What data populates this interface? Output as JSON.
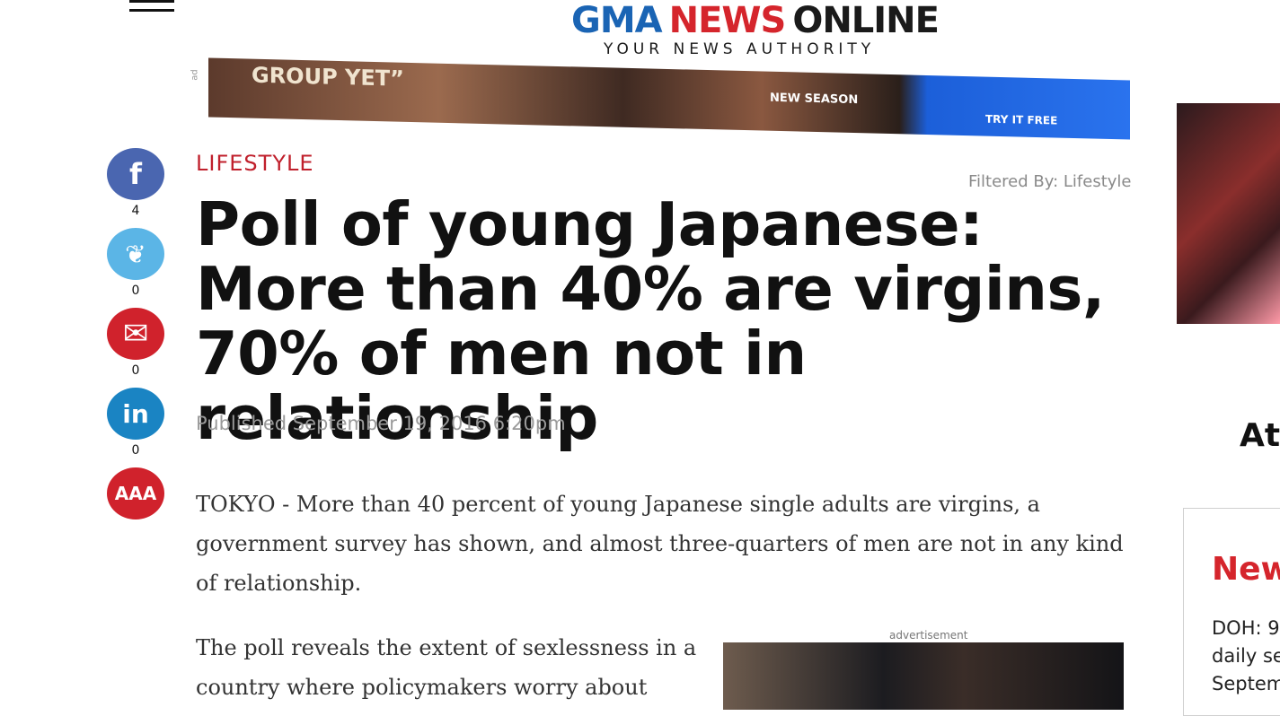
{
  "header": {
    "menu_icon": "hamburger-menu-icon",
    "logo": {
      "gma": "GMA",
      "news": "NEWS",
      "online": "ONLINE",
      "tagline": "YOUR NEWS AUTHORITY"
    }
  },
  "ad_banner": {
    "text_left": "GROUP YET”",
    "text_mid": "NEW SEASON",
    "cta": "TRY IT FREE"
  },
  "social": {
    "facebook": {
      "icon": "facebook-icon",
      "glyph": "f",
      "count": "4",
      "color": "#4a66b0"
    },
    "twitter": {
      "icon": "twitter-icon",
      "glyph": "❦",
      "count": "0",
      "color": "#5bb5e6"
    },
    "email": {
      "icon": "mail-icon",
      "glyph": "✉",
      "count": "0",
      "color": "#d0222c"
    },
    "linkedin": {
      "icon": "linkedin-icon",
      "glyph": "in",
      "count": "0",
      "color": "#1a84c3"
    },
    "font_size": {
      "icon": "font-size-icon",
      "glyph": "AAA",
      "color": "#d0222c"
    }
  },
  "article": {
    "category": "LIFESTYLE",
    "filtered_by": "Filtered By: Lifestyle",
    "headline": "Poll of young Japanese: More than 40% are virgins, 70% of men not in relationship",
    "published": "Published September 19, 2016 6:20pm",
    "paragraph1": "TOKYO - More than 40 percent of young Japanese single adults are virgins, a government survey has shown, and almost three-quarters of men are not in any kind of relationship.",
    "paragraph2": "The poll reveals the extent of sexlessness in a country where policymakers worry about"
  },
  "advertisement_label": "advertisement",
  "sidebar": {
    "section_heading_partial": "At",
    "panel_heading_partial": "New",
    "panel_text_partial": [
      "DOH: 9",
      "daily se",
      "Septem"
    ]
  }
}
